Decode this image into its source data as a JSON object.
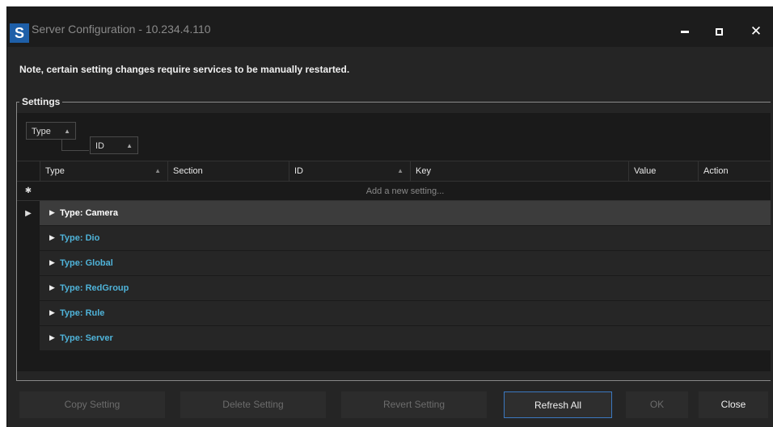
{
  "window": {
    "logo_letter": "S",
    "title": "Server Configuration - 10.234.4.110",
    "minimize_icon": "minimize-icon",
    "maximize_icon": "maximize-icon",
    "close_glyph": "✕"
  },
  "note": "Note, certain setting changes require services to be manually restarted.",
  "settings": {
    "legend": "Settings",
    "group_chips": [
      {
        "label": "Type",
        "sort": "ascending"
      },
      {
        "label": "ID",
        "sort": "ascending"
      }
    ],
    "columns": [
      "Type",
      "Section",
      "ID",
      "Key",
      "Value",
      "Action"
    ],
    "new_row_marker": "✱",
    "new_row_placeholder": "Add a new setting...",
    "current_row_marker": "▶",
    "groups": [
      {
        "label": "Type: Camera",
        "selected": true
      },
      {
        "label": "Type: Dio",
        "selected": false
      },
      {
        "label": "Type: Global",
        "selected": false
      },
      {
        "label": "Type: RedGroup",
        "selected": false
      },
      {
        "label": "Type: Rule",
        "selected": false
      },
      {
        "label": "Type: Server",
        "selected": false
      }
    ]
  },
  "buttons": {
    "copy": "Copy Setting",
    "delete": "Delete Setting",
    "revert": "Revert Setting",
    "refresh": "Refresh All",
    "ok": "OK",
    "close": "Close"
  },
  "colors": {
    "background": "#252525",
    "grid_background": "#1a1a1a",
    "group_link": "#4fb3d9",
    "focus_border": "#3b78c0",
    "logo": "#1e5fa8"
  }
}
